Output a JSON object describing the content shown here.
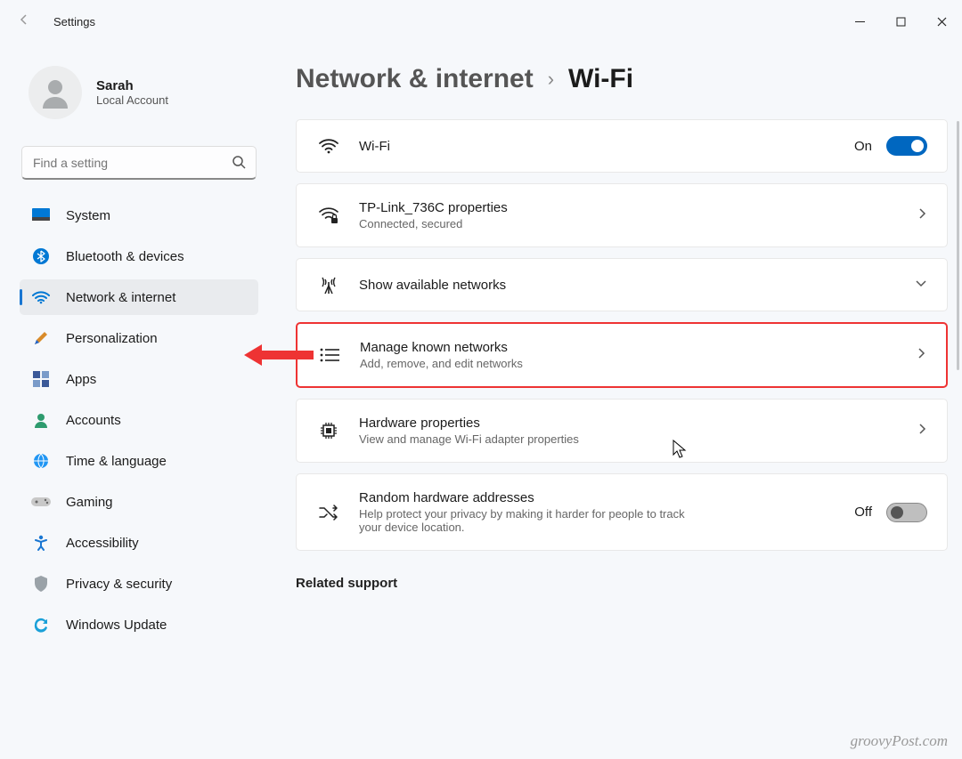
{
  "window": {
    "title": "Settings"
  },
  "profile": {
    "name": "Sarah",
    "subtitle": "Local Account"
  },
  "search": {
    "placeholder": "Find a setting"
  },
  "sidebar": {
    "items": [
      {
        "label": "System"
      },
      {
        "label": "Bluetooth & devices"
      },
      {
        "label": "Network & internet"
      },
      {
        "label": "Personalization"
      },
      {
        "label": "Apps"
      },
      {
        "label": "Accounts"
      },
      {
        "label": "Time & language"
      },
      {
        "label": "Gaming"
      },
      {
        "label": "Accessibility"
      },
      {
        "label": "Privacy & security"
      },
      {
        "label": "Windows Update"
      }
    ]
  },
  "breadcrumb": {
    "parent": "Network & internet",
    "current": "Wi-Fi"
  },
  "cards": {
    "wifi": {
      "title": "Wi-Fi",
      "state": "On"
    },
    "props": {
      "title": "TP-Link_736C properties",
      "sub": "Connected, secured"
    },
    "available": {
      "title": "Show available networks"
    },
    "manage": {
      "title": "Manage known networks",
      "sub": "Add, remove, and edit networks"
    },
    "hardware": {
      "title": "Hardware properties",
      "sub": "View and manage Wi-Fi adapter properties"
    },
    "random": {
      "title": "Random hardware addresses",
      "sub": "Help protect your privacy by making it harder for people to track your device location.",
      "state": "Off"
    }
  },
  "related": {
    "heading": "Related support"
  },
  "watermark": "groovyPost.com"
}
